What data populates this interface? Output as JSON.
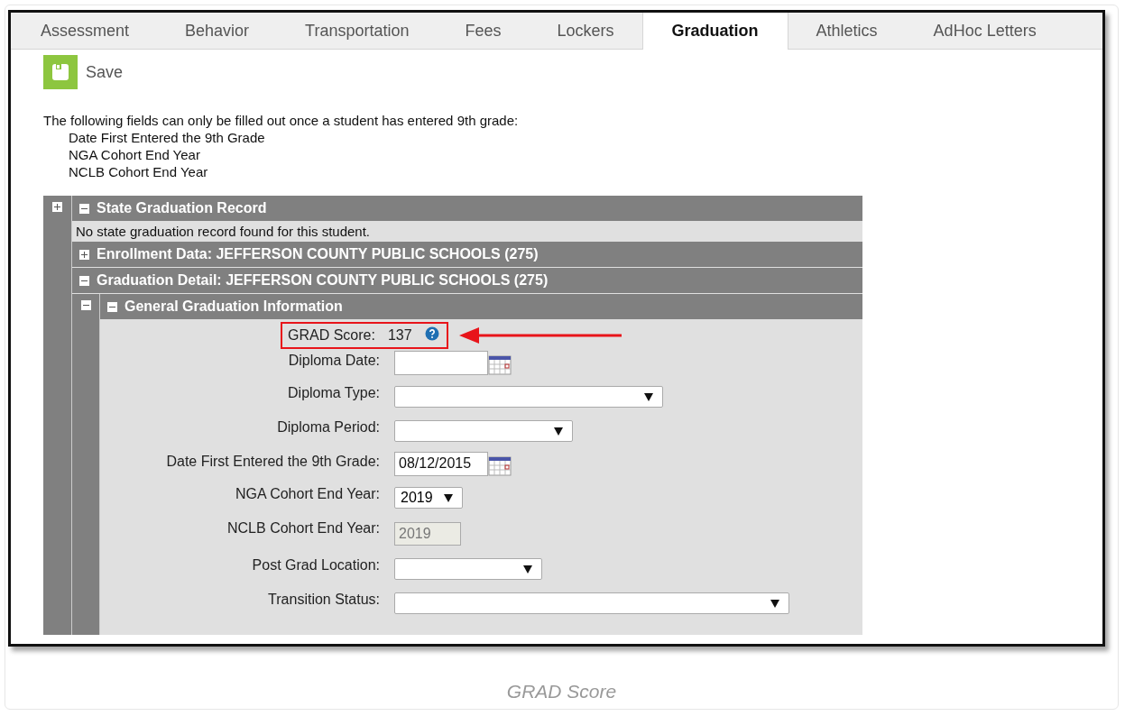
{
  "tabs": [
    {
      "label": "Assessment",
      "selected": false
    },
    {
      "label": "Behavior",
      "selected": false
    },
    {
      "label": "Transportation",
      "selected": false
    },
    {
      "label": "Fees",
      "selected": false
    },
    {
      "label": "Lockers",
      "selected": false
    },
    {
      "label": "Graduation",
      "selected": true
    },
    {
      "label": "Athletics",
      "selected": false
    },
    {
      "label": "AdHoc Letters",
      "selected": false
    }
  ],
  "toolbar": {
    "save": "Save"
  },
  "notice": {
    "text": "The following fields can only be filled out once a student has entered 9th grade:",
    "items": [
      "Date First Entered the 9th Grade",
      "NGA Cohort End Year",
      "NCLB Cohort End Year"
    ]
  },
  "panel": {
    "expanded": false
  },
  "sections": [
    {
      "title": "State Graduation Record",
      "expanded": true,
      "message": "No state graduation record found for this student."
    },
    {
      "title": "Enrollment Data: JEFFERSON COUNTY PUBLIC SCHOOLS (275)",
      "expanded": false
    },
    {
      "title": "Graduation Detail: JEFFERSON COUNTY PUBLIC SCHOOLS (275)",
      "expanded": true,
      "subsections": [
        {
          "title": "General Graduation Information",
          "expanded": true,
          "fields": [
            {
              "kind": "score",
              "label": "GRAD Score:",
              "value": "137",
              "highlighted": true
            },
            {
              "kind": "date",
              "label": "Diploma Date:"
            },
            {
              "kind": "select",
              "label": "Diploma Type:"
            },
            {
              "kind": "select",
              "label": "Diploma Period:"
            },
            {
              "kind": "date",
              "label": "Date First Entered the 9th Grade:",
              "value": "08/12/2015"
            },
            {
              "kind": "select",
              "label": "NGA Cohort End Year:",
              "value": "2019"
            },
            {
              "kind": "readonly",
              "label": "NCLB Cohort End Year:",
              "value": "2019"
            },
            {
              "kind": "select",
              "label": "Post Grad Location:"
            },
            {
              "kind": "select",
              "label": "Transition Status:"
            }
          ]
        }
      ]
    }
  ],
  "caption": "GRAD Score"
}
